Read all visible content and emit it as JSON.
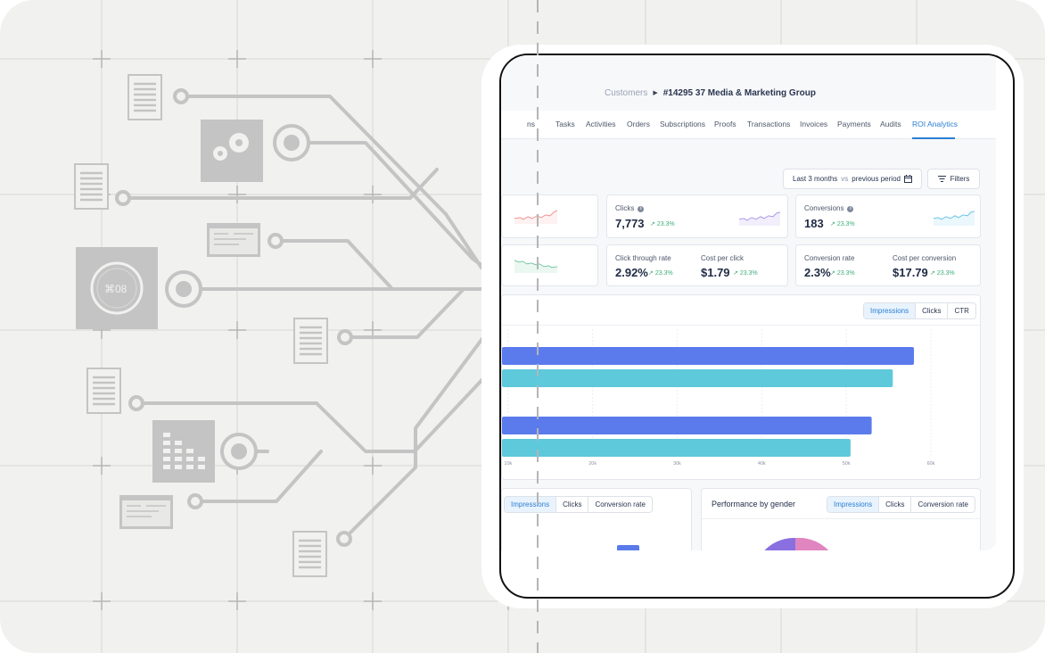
{
  "breadcrumb": {
    "root": "Customers",
    "current": "#14295 37 Media & Marketing Group"
  },
  "tabs": [
    {
      "label": "ns",
      "active": false
    },
    {
      "label": "Tasks",
      "active": false
    },
    {
      "label": "Activities",
      "active": false
    },
    {
      "label": "Orders",
      "active": false
    },
    {
      "label": "Subscriptions",
      "active": false
    },
    {
      "label": "Proofs",
      "active": false
    },
    {
      "label": "Transactions",
      "active": false
    },
    {
      "label": "Invoices",
      "active": false
    },
    {
      "label": "Payments",
      "active": false
    },
    {
      "label": "Audits",
      "active": false
    },
    {
      "label": "ROI Analytics",
      "active": true
    }
  ],
  "controls": {
    "period_main": "Last 3 months",
    "period_vs": "vs",
    "period_compare": "previous period",
    "filters": "Filters"
  },
  "metrics": {
    "clicks": {
      "label": "Clicks",
      "value": "7,773",
      "change": "23.3%"
    },
    "conversions": {
      "label": "Conversions",
      "value": "183",
      "change": "23.3%"
    },
    "ctr": {
      "label": "Click through rate",
      "value": "2.92%",
      "change": "23.3%"
    },
    "cpc": {
      "label": "Cost per click",
      "value": "$1.79",
      "change": "23.3%"
    },
    "conv_rate": {
      "label": "Conversion rate",
      "value": "2.3%",
      "change": "23.3%"
    },
    "cost_per_conv": {
      "label": "Cost per conversion",
      "value": "$17.79",
      "change": "23.3%"
    }
  },
  "main_chart": {
    "toggles": [
      "Impressions",
      "Clicks",
      "CTR"
    ],
    "active": "Impressions"
  },
  "left_card": {
    "toggles": [
      "Impressions",
      "Clicks",
      "Conversion rate"
    ],
    "active": "Impressions"
  },
  "gender_card": {
    "title": "Performance by gender",
    "toggles": [
      "Impressions",
      "Clicks",
      "Conversion rate"
    ],
    "active": "Impressions"
  },
  "illustration": {
    "dial_text": "⌘08"
  },
  "colors": {
    "accent": "#2a7fd4",
    "bar_primary": "#5b7bec",
    "bar_secondary": "#5ec9db",
    "positive": "#3fae7a"
  },
  "chart_data": {
    "type": "bar",
    "orientation": "horizontal",
    "x_ticks": [
      "10k",
      "20k",
      "30k",
      "40k",
      "50k",
      "60k"
    ],
    "xlim": [
      0,
      60000
    ],
    "series": [
      {
        "values": [
          58000,
          55500
        ]
      },
      {
        "values": [
          53000,
          50500
        ]
      }
    ],
    "grid": true
  }
}
